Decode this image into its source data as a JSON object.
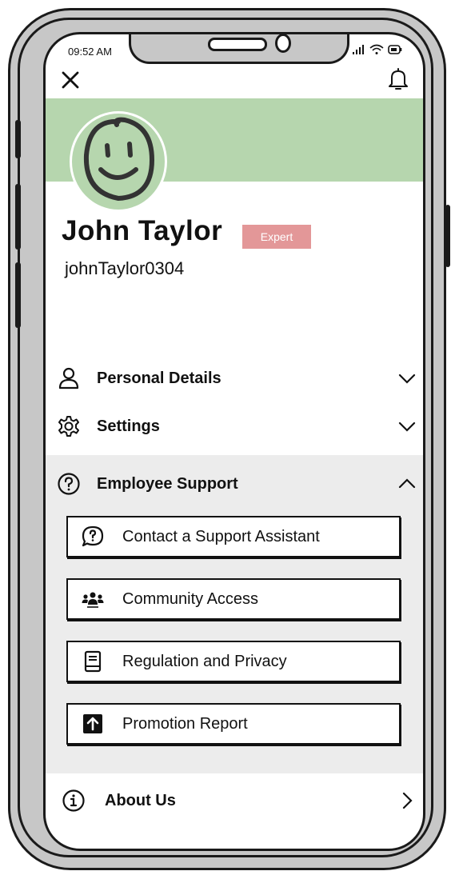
{
  "status_bar": {
    "time": "09:52 AM"
  },
  "header": {
    "close_icon": "close-icon",
    "notification_icon": "bell-icon"
  },
  "profile": {
    "name": "John Taylor",
    "badge": "Expert",
    "handle": "johnTaylor0304",
    "banner_color": "#b6d6ae",
    "badge_color": "#e39798"
  },
  "menu": {
    "personal_details": "Personal Details",
    "settings": "Settings",
    "employee_support": "Employee Support",
    "about_us": "About Us"
  },
  "support_items": [
    {
      "label": "Contact a Support Assistant",
      "icon": "chat-question-icon"
    },
    {
      "label": "Community Access",
      "icon": "people-icon"
    },
    {
      "label": "Regulation and Privacy",
      "icon": "book-icon"
    },
    {
      "label": "Promotion Report",
      "icon": "arrow-up-icon"
    }
  ]
}
